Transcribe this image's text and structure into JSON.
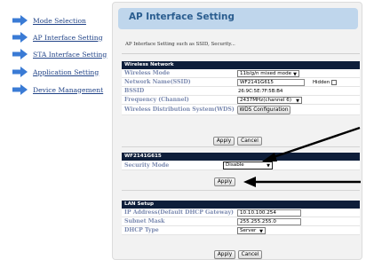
{
  "sidebar": {
    "items": [
      {
        "label": "Mode Selection"
      },
      {
        "label": "AP Interface Setting"
      },
      {
        "label": "STA Interface Setting"
      },
      {
        "label": "Application Setting"
      },
      {
        "label": "Device Management"
      }
    ],
    "arrow_color": "#3a7bd5"
  },
  "page": {
    "title": "AP Interface Setting",
    "description": "AP Interface Setting such as SSID, Security..."
  },
  "wireless": {
    "header": "Wireless Network",
    "mode_label": "Wireless Mode",
    "mode_value": "11b/g/n mixed mode",
    "ssid_label": "Network Name(SSID)",
    "ssid_value": "WF2141G615",
    "hidden_label": "Hidden",
    "bssid_label": "BSSID",
    "bssid_value": "26:9C:5E:7F:5B:B4",
    "freq_label": "Frequency (Channel)",
    "freq_value": "2437MHz(channel 6)",
    "wds_label": "Wireless Distribution System(WDS)",
    "wds_button": "WDS Configuration",
    "apply": "Apply",
    "cancel": "Cancel"
  },
  "security": {
    "header": "WF2141G615",
    "mode_label": "Security Mode",
    "mode_value": "Disable",
    "apply": "Apply"
  },
  "lan": {
    "header": "LAN Setup",
    "ip_label": "IP Address(Default DHCP Gateway)",
    "ip_value": "10.10.100.254",
    "mask_label": "Subnet Mask",
    "mask_value": "255.255.255.0",
    "dhcp_label": "DHCP Type",
    "dhcp_value": "Server",
    "apply": "Apply",
    "cancel": "Cancel"
  },
  "colors": {
    "title_bar": "#bfd6ec",
    "section_header": "#0e1e3a",
    "row_label": "#7b8ab0",
    "annotation_arrows": "#000000"
  }
}
